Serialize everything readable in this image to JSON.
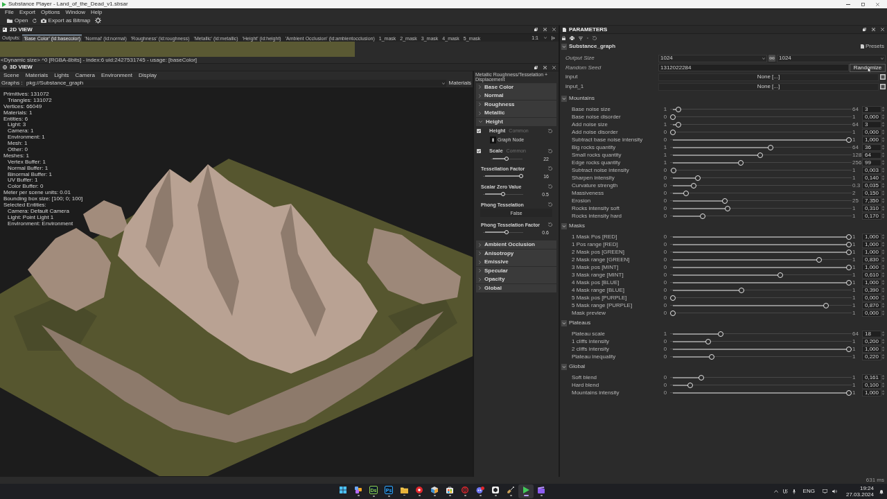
{
  "title_bar": {
    "title": "Substance Player - Land_of_the_Dead_v1.sbsar"
  },
  "menu": [
    "File",
    "Export",
    "Options",
    "Window",
    "Help"
  ],
  "toolbar": [
    {
      "kind": "open",
      "label": "Open"
    },
    {
      "kind": "refresh"
    },
    {
      "kind": "export",
      "label": "Export as Bitmap"
    },
    {
      "kind": "settings"
    }
  ],
  "view_2d": {
    "title": "2D VIEW",
    "outputs_label": "Outputs:",
    "outputs": [
      {
        "label": "'Base Color' (id:basecolor)",
        "selected": true
      },
      {
        "label": "'Normal' (id:normal)",
        "selected": false
      },
      {
        "label": "'Roughness' (id:roughness)",
        "selected": false
      },
      {
        "label": "'Metallic' (id:metallic)",
        "selected": false
      },
      {
        "label": "'Height' (id:height)",
        "selected": false
      },
      {
        "label": "'Ambient Occlusion' (id:ambientocclusion)",
        "selected": false
      },
      {
        "label": "1_mask",
        "selected": false
      },
      {
        "label": "2_mask",
        "selected": false
      },
      {
        "label": "3_mask",
        "selected": false
      },
      {
        "label": "4_mask",
        "selected": false
      },
      {
        "label": "5_mask",
        "selected": false
      }
    ],
    "zoom": "1:1",
    "info": "<Dynamic size> ^0 [RGBA-8bits] - index:6 uid:2427531745 - usage: [baseColor]"
  },
  "view_3d": {
    "title": "3D VIEW",
    "menu": [
      "Scene",
      "Materials",
      "Lights",
      "Camera",
      "Environment",
      "Display"
    ],
    "graphs_label": "Graphs :",
    "graph": "pkg://Substance_graph",
    "materials_label": "Materials",
    "stats": [
      {
        "text": "Primitives: 131072",
        "children": [
          {
            "text": "Triangles: 131072"
          }
        ]
      },
      {
        "text": "Vertices: 66049"
      },
      {
        "text": "Materials: 1"
      },
      {
        "text": "Entities: 6",
        "children": [
          {
            "text": "Light: 3"
          },
          {
            "text": "Camera: 1"
          },
          {
            "text": "Environment: 1"
          },
          {
            "text": "Mesh: 1"
          },
          {
            "text": "Other: 0"
          }
        ]
      },
      {
        "text": "Meshes: 1",
        "children": [
          {
            "text": "Vertex Buffer: 1"
          },
          {
            "text": "Normal Buffer: 1"
          },
          {
            "text": "Binormal Buffer: 1"
          },
          {
            "text": "UV Buffer: 1"
          },
          {
            "text": "Color Buffer: 0"
          }
        ]
      },
      {
        "text": "Meter per scene units: 0.01"
      },
      {
        "text": "Bounding box size: [100; 0; 100]"
      },
      {
        "text": "Selected Entities:",
        "children": [
          {
            "text": "Camera: Default Camera"
          },
          {
            "text": "Light: Point Light 1"
          },
          {
            "text": "Environment: Environment"
          }
        ]
      }
    ]
  },
  "material_panel": {
    "title": "Metallic Roughness/Tesselation + Displacement",
    "sections": [
      {
        "label": "Base Color",
        "expanded": false
      },
      {
        "label": "Normal",
        "expanded": false
      },
      {
        "label": "Roughness",
        "expanded": false
      },
      {
        "label": "Metallic",
        "expanded": false
      },
      {
        "label": "Height",
        "expanded": true,
        "items": [
          {
            "kind": "channel",
            "label": "Height",
            "tag": "Common",
            "checked": true,
            "node": "Graph Node"
          },
          {
            "kind": "channel_slider",
            "label": "Scale",
            "tag": "Common",
            "checked": true,
            "level": 0.5,
            "value": "22"
          },
          {
            "kind": "slider",
            "label": "Tessellation Factor",
            "level": 1,
            "value": "16"
          },
          {
            "kind": "slider",
            "label": "Scalar Zero Value",
            "level": 0.5,
            "value": "0.5"
          },
          {
            "kind": "choice",
            "label": "Phong Tesselation",
            "value": "False"
          },
          {
            "kind": "slider",
            "label": "Phong Tesselation Factor",
            "level": 0.6,
            "value": "0.6"
          }
        ]
      },
      {
        "label": "Ambient Occlusion",
        "expanded": false
      },
      {
        "label": "Anisotropy",
        "expanded": false
      },
      {
        "label": "Emissive",
        "expanded": false
      },
      {
        "label": "Specular",
        "expanded": false
      },
      {
        "label": "Opacity",
        "expanded": false
      },
      {
        "label": "Global",
        "expanded": false
      }
    ]
  },
  "parameters": {
    "title": "PARAMETERS",
    "graph": {
      "label": "Substance_graph",
      "expanded": true
    },
    "presets": "Presets",
    "fields": [
      {
        "kind": "size",
        "label": "Output Size",
        "value": "1024",
        "value_2": "1024"
      },
      {
        "kind": "seed",
        "label": "Random Seed",
        "value": "1312022284",
        "button": "Randomize"
      },
      {
        "kind": "image",
        "label": "input",
        "value": "None [...]"
      },
      {
        "kind": "image",
        "label": "input_1",
        "value": "None [...]"
      }
    ],
    "groups": [
      {
        "label": "Mountains",
        "expanded": true,
        "sliders": [
          {
            "label": "Base noise size",
            "min": "1",
            "max": "64",
            "value": "3",
            "level": 0.032
          },
          {
            "label": "Base noise disorder",
            "min": "0",
            "max": "1",
            "value": "0,000",
            "level": 0
          },
          {
            "label": "Add noise size",
            "min": "1",
            "max": "64",
            "value": "3",
            "level": 0.032
          },
          {
            "label": "Add noise disorder",
            "min": "0",
            "max": "1",
            "value": "0,000",
            "level": 0
          },
          {
            "label": "Subtract base noise intensity",
            "min": "0",
            "max": "1",
            "value": "1,000",
            "level": 1
          },
          {
            "label": "Big rocks quantity",
            "min": "1",
            "max": "64",
            "value": "36",
            "level": 0.556
          },
          {
            "label": "Small rocks quantity",
            "min": "1",
            "max": "128",
            "value": "64",
            "level": 0.496
          },
          {
            "label": "Edge rocks quantity",
            "min": "1",
            "max": "256",
            "value": "99",
            "level": 0.384
          },
          {
            "label": "Subtract noise intensity",
            "min": "0",
            "max": "1",
            "value": "0,003",
            "level": 0.003
          },
          {
            "label": "Sharpen intensity",
            "min": "0",
            "max": "1",
            "value": "0,140",
            "level": 0.14
          },
          {
            "label": "Curvature strength",
            "min": "0",
            "max": "0.3",
            "value": "0,035",
            "level": 0.117
          },
          {
            "label": "Massiveness",
            "min": "0",
            "max": "2",
            "value": "0,150",
            "level": 0.075
          },
          {
            "label": "Erosion",
            "min": "0",
            "max": "25",
            "value": "7,350",
            "level": 0.294
          },
          {
            "label": "Rocks intensity soft",
            "min": "0",
            "max": "1",
            "value": "0,310",
            "level": 0.31
          },
          {
            "label": "Rocks intensity hard",
            "min": "0",
            "max": "1",
            "value": "0,170",
            "level": 0.17
          }
        ]
      },
      {
        "label": "Masks",
        "expanded": true,
        "sliders": [
          {
            "label": "1 Mask Pos [RED]",
            "min": "0",
            "max": "1",
            "value": "1,000",
            "level": 1
          },
          {
            "label": "1 Pos range [RED]",
            "min": "0",
            "max": "1",
            "value": "1,000",
            "level": 1
          },
          {
            "label": "2 Mask pos [GREEN]",
            "min": "0",
            "max": "1",
            "value": "1,000",
            "level": 1
          },
          {
            "label": "2 Mask range [GREEN]",
            "min": "0",
            "max": "1",
            "value": "0,830",
            "level": 0.83
          },
          {
            "label": "3 Mask pos [MINT]",
            "min": "0",
            "max": "1",
            "value": "1,000",
            "level": 1
          },
          {
            "label": "3 Mask range [MINT]",
            "min": "0",
            "max": "1",
            "value": "0,610",
            "level": 0.61
          },
          {
            "label": "4 Mask pos [BLUE]",
            "min": "0",
            "max": "1",
            "value": "1,000",
            "level": 1
          },
          {
            "label": "4 Mask range [BLUE]",
            "min": "0",
            "max": "1",
            "value": "0,390",
            "level": 0.39
          },
          {
            "label": "5 Mask pos [PURPLE]",
            "min": "0",
            "max": "1",
            "value": "0,000",
            "level": 0
          },
          {
            "label": "5 Mask range [PURPLE]",
            "min": "0",
            "max": "1",
            "value": "0,870",
            "level": 0.87
          },
          {
            "label": "Mask preview",
            "min": "0",
            "max": "1",
            "value": "0,000",
            "level": 0
          }
        ]
      },
      {
        "label": "Plateaus",
        "expanded": true,
        "sliders": [
          {
            "label": "Plateau scale",
            "min": "1",
            "max": "64",
            "value": "18",
            "level": 0.27
          },
          {
            "label": "1 cliffs intensity",
            "min": "0",
            "max": "1",
            "value": "0,200",
            "level": 0.2
          },
          {
            "label": "2 cliffs intensity",
            "min": "0",
            "max": "1",
            "value": "1,000",
            "level": 1
          },
          {
            "label": "Plateau inequality",
            "min": "0",
            "max": "1",
            "value": "0,220",
            "level": 0.22
          }
        ]
      },
      {
        "label": "Global",
        "expanded": true,
        "sliders": [
          {
            "label": "Soft blend",
            "min": "0",
            "max": "1",
            "value": "0,161",
            "level": 0.161
          },
          {
            "label": "Hard blend",
            "min": "0",
            "max": "1",
            "value": "0,100",
            "level": 0.1
          },
          {
            "label": "Mountains intensity",
            "min": "0",
            "max": "1",
            "value": "1,000",
            "level": 1
          }
        ]
      }
    ]
  },
  "status_bar": {
    "timing": "631 ms"
  },
  "taskbar": {
    "apps": [
      {
        "kind": "start",
        "running": false,
        "active": false
      },
      {
        "kind": "widgets",
        "running": true,
        "active": false
      },
      {
        "kind": "letter",
        "label": "Ds",
        "color": "#8fd14f",
        "running": true,
        "active": false
      },
      {
        "kind": "letter",
        "label": "Ps",
        "color": "#31a8ff",
        "running": true,
        "active": false
      },
      {
        "kind": "folder",
        "running": true,
        "active": false
      },
      {
        "kind": "record",
        "running": true,
        "active": false
      },
      {
        "kind": "package",
        "running": true,
        "active": false
      },
      {
        "kind": "store",
        "running": true,
        "active": false
      },
      {
        "kind": "ring",
        "running": true,
        "active": false
      },
      {
        "kind": "chat",
        "badge": true,
        "running": true,
        "active": false
      },
      {
        "kind": "hexagon",
        "running": true,
        "active": false
      },
      {
        "kind": "shovel",
        "running": true,
        "active": false
      },
      {
        "kind": "play",
        "running": true,
        "active": true
      },
      {
        "kind": "clapper",
        "running": true,
        "active": false
      }
    ],
    "language": "ENG",
    "time": "19:24",
    "date": "27.03.2024"
  }
}
